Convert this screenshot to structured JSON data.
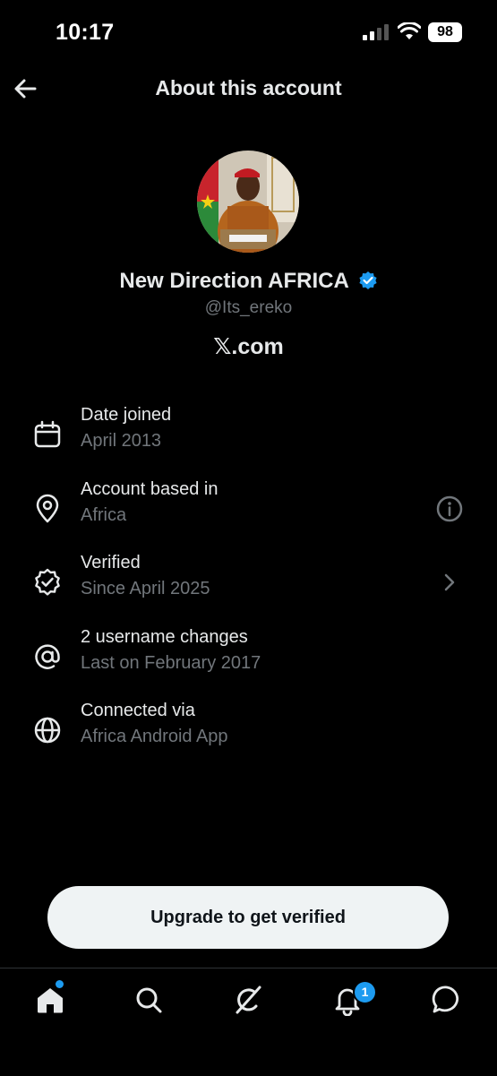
{
  "status_bar": {
    "time": "10:17",
    "battery": "98"
  },
  "header": {
    "title": "About this account"
  },
  "profile": {
    "name": "New Direction AFRICA",
    "handle": "@Its_ereko",
    "site": "𝕏.com",
    "verified_color": "#1d9bf0"
  },
  "rows": [
    {
      "icon": "calendar-icon",
      "title": "Date joined",
      "subtitle": "April 2013"
    },
    {
      "icon": "location-pin-icon",
      "title": "Account based in",
      "subtitle": "Africa",
      "trailing": "info-icon"
    },
    {
      "icon": "verified-badge-icon",
      "title": "Verified",
      "subtitle": "Since April 2025",
      "trailing": "chevron-right-icon"
    },
    {
      "icon": "at-sign-icon",
      "title": "2 username changes",
      "subtitle": "Last on February 2017"
    },
    {
      "icon": "globe-icon",
      "title": "Connected via",
      "subtitle": "Africa Android App"
    }
  ],
  "upgrade_button": {
    "label": "Upgrade to get verified"
  },
  "tab_bar": {
    "tabs": [
      "home-icon",
      "search-icon",
      "grok-icon",
      "bell-icon",
      "chat-icon"
    ],
    "notification_count": "1",
    "accent": "#1d9bf0"
  }
}
